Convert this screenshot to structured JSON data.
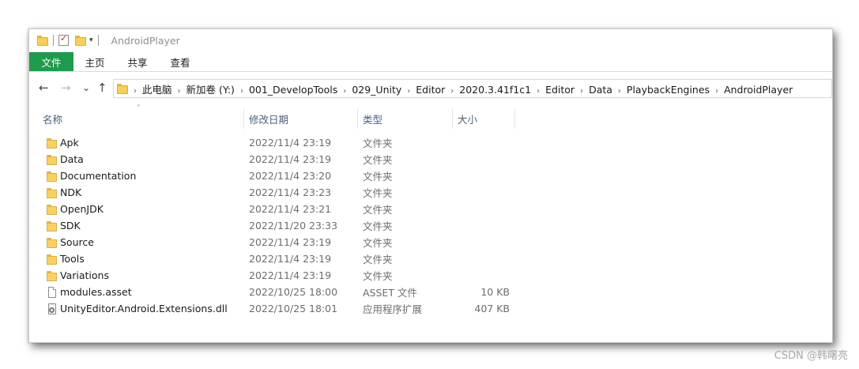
{
  "window": {
    "title": "AndroidPlayer"
  },
  "ribbon": {
    "tabs": [
      "文件",
      "主页",
      "共享",
      "查看"
    ]
  },
  "nav": {
    "back": "←",
    "forward": "→",
    "recent": "⌄",
    "up": "↑"
  },
  "breadcrumb": [
    "此电脑",
    "新加卷 (Y:)",
    "001_DevelopTools",
    "029_Unity",
    "Editor",
    "2020.3.41f1c1",
    "Editor",
    "Data",
    "PlaybackEngines",
    "AndroidPlayer"
  ],
  "columns": {
    "name": "名称",
    "date": "修改日期",
    "type": "类型",
    "size": "大小"
  },
  "files": [
    {
      "icon": "folder-icon",
      "name": "Apk",
      "date": "2022/11/4 23:19",
      "type": "文件夹",
      "size": ""
    },
    {
      "icon": "folder-icon",
      "name": "Data",
      "date": "2022/11/4 23:19",
      "type": "文件夹",
      "size": ""
    },
    {
      "icon": "folder-icon",
      "name": "Documentation",
      "date": "2022/11/4 23:20",
      "type": "文件夹",
      "size": ""
    },
    {
      "icon": "folder-icon",
      "name": "NDK",
      "date": "2022/11/4 23:23",
      "type": "文件夹",
      "size": ""
    },
    {
      "icon": "folder-icon",
      "name": "OpenJDK",
      "date": "2022/11/4 23:21",
      "type": "文件夹",
      "size": ""
    },
    {
      "icon": "folder-icon",
      "name": "SDK",
      "date": "2022/11/20 23:33",
      "type": "文件夹",
      "size": ""
    },
    {
      "icon": "folder-icon",
      "name": "Source",
      "date": "2022/11/4 23:19",
      "type": "文件夹",
      "size": ""
    },
    {
      "icon": "folder-icon",
      "name": "Tools",
      "date": "2022/11/4 23:19",
      "type": "文件夹",
      "size": ""
    },
    {
      "icon": "folder-icon",
      "name": "Variations",
      "date": "2022/11/4 23:19",
      "type": "文件夹",
      "size": ""
    },
    {
      "icon": "file-icon",
      "name": "modules.asset",
      "date": "2022/10/25 18:00",
      "type": "ASSET 文件",
      "size": "10 KB"
    },
    {
      "icon": "dll-icon",
      "name": "UnityEditor.Android.Extensions.dll",
      "date": "2022/10/25 18:01",
      "type": "应用程序扩展",
      "size": "407 KB"
    }
  ],
  "watermark": "CSDN @韩曙亮",
  "colors": {
    "file_tab": "#1e9b4d",
    "folder": "#f8d064",
    "header_text": "#4c607a"
  }
}
